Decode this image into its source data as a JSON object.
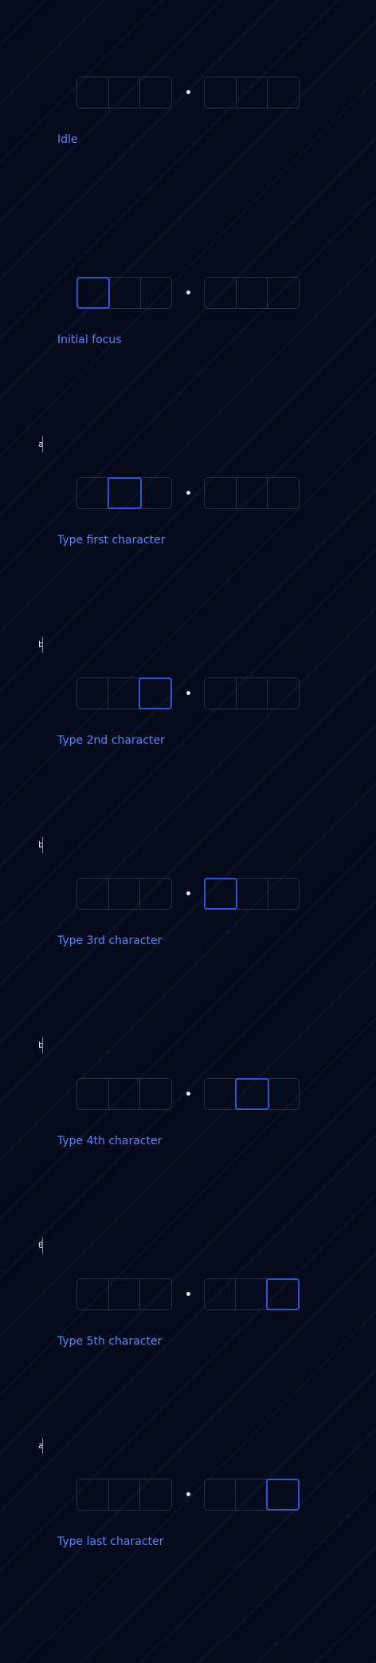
{
  "colors": {
    "background": "#050a1c",
    "slot_border": "#2a3145",
    "active_border": "#2f55d4",
    "caption": "#5b86f5",
    "separator": "#e8ecf5"
  },
  "separator_icon": "dot-icon",
  "states": [
    {
      "caption": "Idle",
      "active_slot": null,
      "typed_value": ""
    },
    {
      "caption": "Initial focus",
      "active_slot": 0,
      "typed_value": ""
    },
    {
      "caption": "Type first character",
      "active_slot": 1,
      "typed_value": "a"
    },
    {
      "caption": "Type 2nd character",
      "active_slot": 2,
      "typed_value": "b"
    },
    {
      "caption": "Type 3rd character",
      "active_slot": 3,
      "typed_value": "b"
    },
    {
      "caption": "Type 4th character",
      "active_slot": 4,
      "typed_value": "b"
    },
    {
      "caption": "Type 5th character",
      "active_slot": 5,
      "typed_value": "0"
    },
    {
      "caption": "Type last character",
      "active_slot": 5,
      "typed_value": "a"
    }
  ]
}
